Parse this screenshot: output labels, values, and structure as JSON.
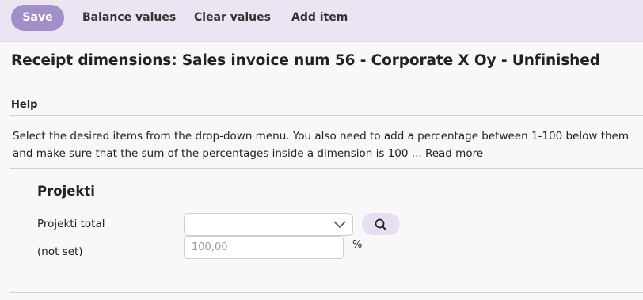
{
  "toolbar": {
    "save_label": "Save",
    "balance_label": "Balance values",
    "clear_label": "Clear values",
    "add_label": "Add item"
  },
  "page": {
    "title": "Receipt dimensions: Sales invoice num 56 - Corporate X Oy - Unfinished"
  },
  "help": {
    "heading": "Help",
    "text": "Select the desired items from the drop-down menu. You also need to add a percentage between 1-100 below them and make sure that the sum of the percentages inside a dimension is 100 ...",
    "read_more": "Read more"
  },
  "dimension": {
    "title": "Projekti",
    "total_label": "Projekti total",
    "selected_value": "",
    "row_label": "(not set)",
    "percentage_placeholder": "100,00",
    "percentage_unit": "%"
  },
  "icons": {
    "dropdown": "chevron-down-icon",
    "search": "search-icon"
  },
  "colors": {
    "toolbar_bg": "#ebe5f3",
    "primary": "#a28fc7",
    "search_button_bg": "#e5dff0"
  }
}
